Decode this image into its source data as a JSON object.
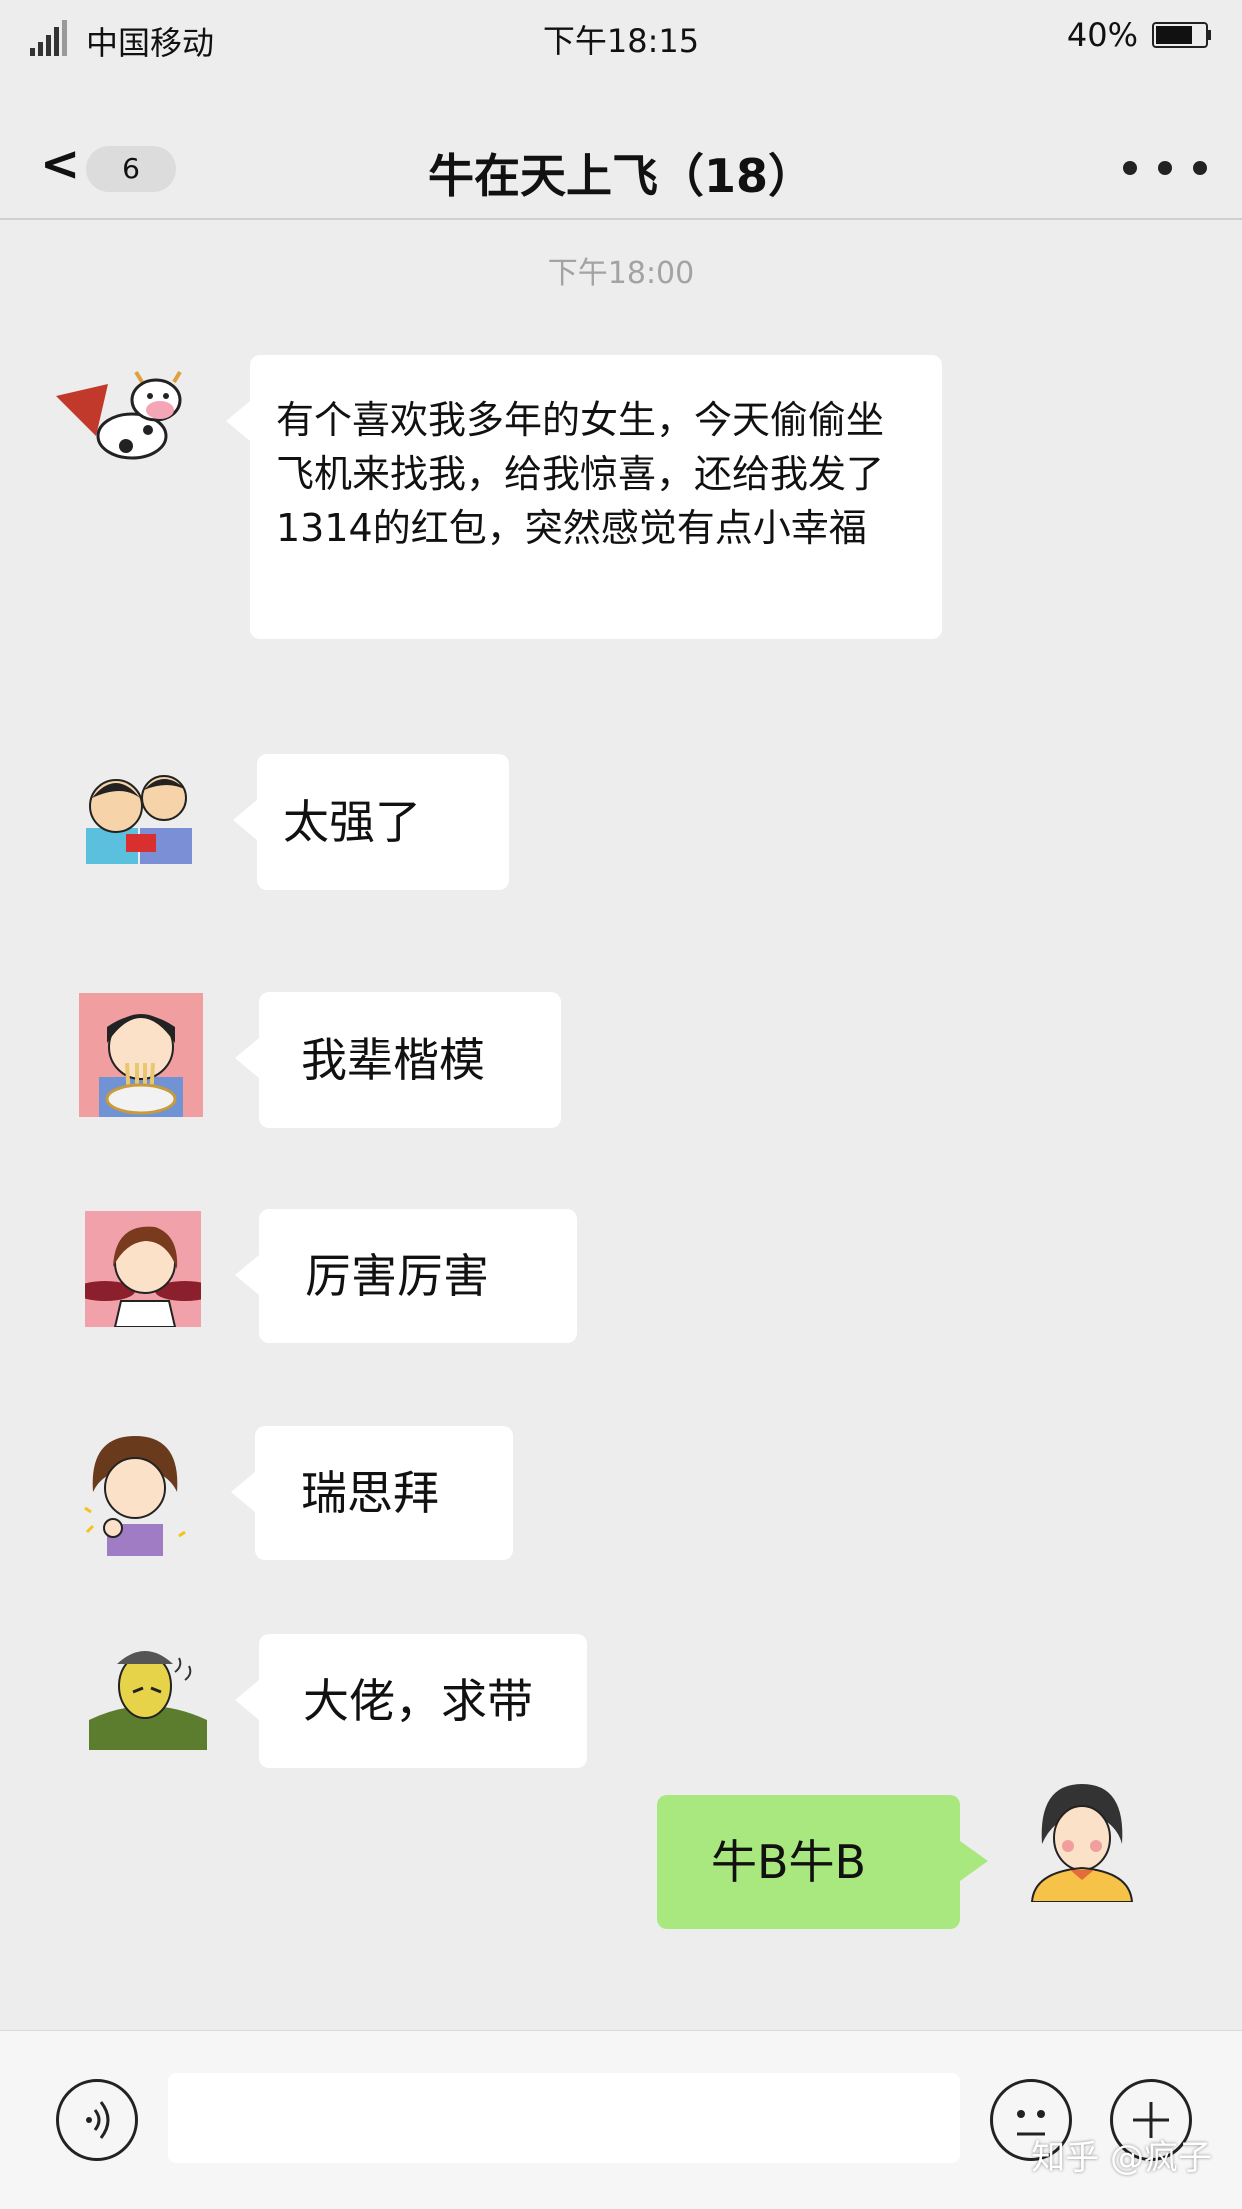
{
  "status_bar": {
    "carrier": "中国移动",
    "time": "下午18:15",
    "battery": "40%",
    "battery_level": 0.4
  },
  "nav": {
    "back_label": "<",
    "unread_count": "6",
    "title": "牛在天上飞（18）"
  },
  "chat": {
    "timestamp": "下午18:00",
    "messages": [
      {
        "text": "有个喜欢我多年的女生，今天偷偷坐飞机来找我，给我惊喜，还给我发了1314的红包，突然感觉有点小幸福",
        "direction": "received",
        "avatar": "flying-cow-avatar"
      },
      {
        "text": "太强了",
        "direction": "received",
        "avatar": "two-kids-avatar"
      },
      {
        "text": "我辈楷模",
        "direction": "received",
        "avatar": "noodle-girl-avatar"
      },
      {
        "text": "厉害厉害",
        "direction": "received",
        "avatar": "smiling-girl-avatar"
      },
      {
        "text": "瑞思拜",
        "direction": "received",
        "avatar": "thumbs-up-girl-avatar"
      },
      {
        "text": "大佬，求带",
        "direction": "received",
        "avatar": "cartoon-man-avatar"
      },
      {
        "text": "牛B牛B",
        "direction": "sent",
        "avatar": "my-avatar"
      }
    ]
  },
  "input_bar": {
    "input_value": "",
    "placeholder": ""
  },
  "watermark": "知乎 @疯子",
  "colors": {
    "background": "#ededed",
    "sent_bubble": "#a9e87e",
    "received_bubble": "#ffffff"
  }
}
